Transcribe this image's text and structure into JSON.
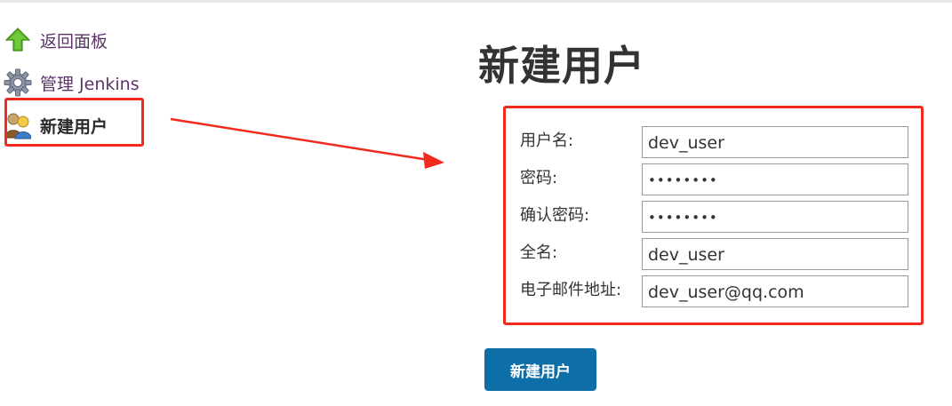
{
  "sidebar": {
    "items": [
      {
        "label": "返回面板",
        "icon": "up-arrow-icon"
      },
      {
        "label": "管理 Jenkins",
        "icon": "gear-icon"
      },
      {
        "label": "新建用户",
        "icon": "user-icon"
      }
    ]
  },
  "main": {
    "title": "新建用户",
    "form": {
      "fields": [
        {
          "label": "用户名:",
          "value": "dev_user",
          "type": "text"
        },
        {
          "label": "密码:",
          "value": "••••••••",
          "type": "password"
        },
        {
          "label": "确认密码:",
          "value": "••••••••",
          "type": "password"
        },
        {
          "label": "全名:",
          "value": "dev_user",
          "type": "text"
        },
        {
          "label": "电子邮件地址:",
          "value": "dev_user@qq.com",
          "type": "text"
        }
      ]
    },
    "submit_label": "新建用户"
  },
  "colors": {
    "accent": "#0d6ea8",
    "highlight": "#f02a1e",
    "link": "#5c3566"
  }
}
